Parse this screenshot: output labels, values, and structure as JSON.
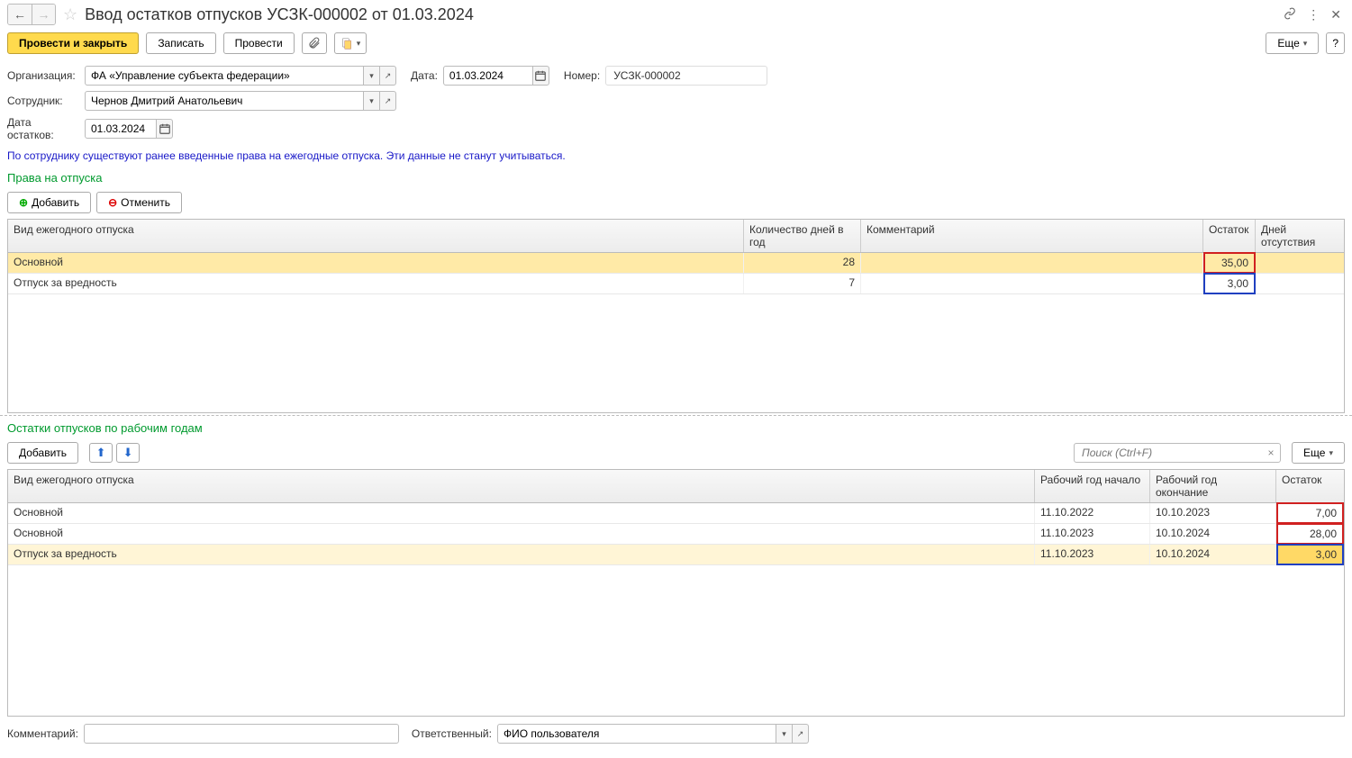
{
  "title": "Ввод остатков отпусков УСЗК-000002 от 01.03.2024",
  "toolbar": {
    "post_close": "Провести и закрыть",
    "write": "Записать",
    "post": "Провести",
    "more": "Еще",
    "help": "?"
  },
  "form": {
    "org_label": "Организация:",
    "org_value": "ФА «Управление субъекта федерации»",
    "date_label": "Дата:",
    "date_value": "01.03.2024",
    "number_label": "Номер:",
    "number_value": "УСЗК-000002",
    "employee_label": "Сотрудник:",
    "employee_value": "Чернов Дмитрий Анатольевич",
    "balance_date_label": "Дата остатков:",
    "balance_date_value": "01.03.2024"
  },
  "info_text": "По сотруднику существуют ранее введенные права на ежегодные отпуска. Эти данные не станут учитываться.",
  "section1": {
    "title": "Права на отпуска",
    "add": "Добавить",
    "cancel": "Отменить",
    "headers": {
      "type": "Вид ежегодного отпуска",
      "days": "Количество дней в год",
      "comment": "Комментарий",
      "balance": "Остаток",
      "absent": "Дней отсутствия"
    },
    "rows": [
      {
        "type": "Основной",
        "days": "28",
        "comment": "",
        "balance": "35,00",
        "absent": ""
      },
      {
        "type": "Отпуск за вредность",
        "days": "7",
        "comment": "",
        "balance": "3,00",
        "absent": ""
      }
    ]
  },
  "section2": {
    "title": "Остатки отпусков по рабочим годам",
    "add": "Добавить",
    "search_placeholder": "Поиск (Ctrl+F)",
    "more": "Еще",
    "headers": {
      "type": "Вид ежегодного отпуска",
      "start": "Рабочий год начало",
      "end": "Рабочий год окончание",
      "balance": "Остаток"
    },
    "rows": [
      {
        "type": "Основной",
        "start": "11.10.2022",
        "end": "10.10.2023",
        "balance": "7,00"
      },
      {
        "type": "Основной",
        "start": "11.10.2023",
        "end": "10.10.2024",
        "balance": "28,00"
      },
      {
        "type": "Отпуск за вредность",
        "start": "11.10.2023",
        "end": "10.10.2024",
        "balance": "3,00"
      }
    ]
  },
  "footer": {
    "comment_label": "Комментарий:",
    "responsible_label": "Ответственный:",
    "responsible_value": "ФИО пользователя"
  }
}
